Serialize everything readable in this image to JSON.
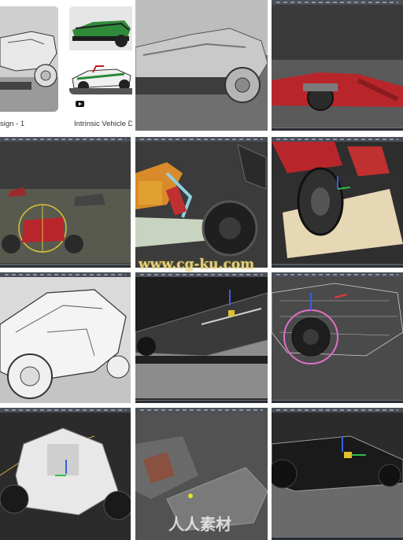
{
  "gallery": {
    "cards": [
      {
        "caption": "sign - 1"
      },
      {
        "caption": "Intrinsic Vehicle D"
      }
    ],
    "watermark_url": "www.cg-ku.com",
    "watermark_brand": "人人素材"
  },
  "colors": {
    "viewport_gray": "#3a3a3a",
    "chassis_red": "#b8262b",
    "sketch_white": "#e8e8e8",
    "wire_pink": "#e070c8"
  }
}
